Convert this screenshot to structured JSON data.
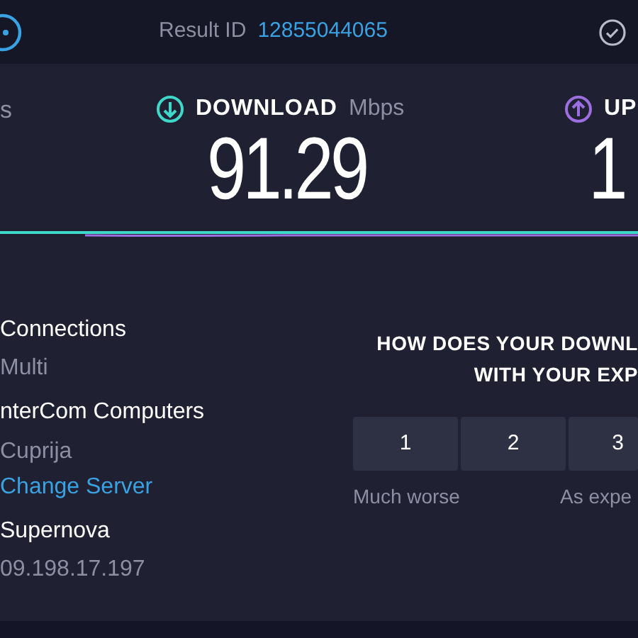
{
  "header": {
    "label": "Result ID",
    "result_id": "12855044065"
  },
  "metrics": [
    {
      "kind": "unit_only",
      "unit": "s"
    },
    {
      "kind": "download",
      "label": "DOWNLOAD",
      "unit": "Mbps",
      "value": "91.29"
    },
    {
      "kind": "upload",
      "label": "UP",
      "value": "1"
    }
  ],
  "details": [
    {
      "title": "Connections",
      "value": "Multi"
    },
    {
      "title": "nterCom Computers",
      "value": "Cuprija",
      "link": "Change Server"
    },
    {
      "title": "Supernova",
      "value": "09.198.17.197"
    }
  ],
  "survey": {
    "question_lines": [
      "HOW DOES YOUR DOWNL",
      "WITH YOUR EXP"
    ],
    "options": [
      "1",
      "2",
      "3"
    ],
    "low_label": "Much worse",
    "mid_label": "As expe"
  }
}
